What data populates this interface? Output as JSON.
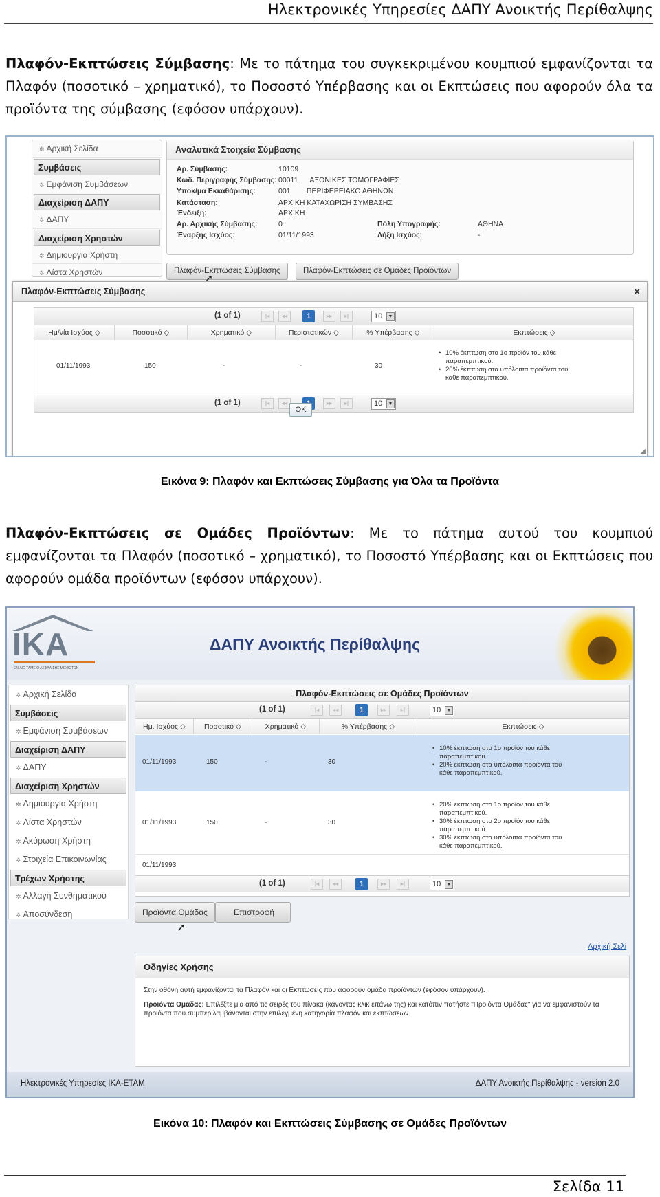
{
  "header": {
    "title": "Ηλεκτρονικές Υπηρεσίες ΔΑΠΥ Ανοικτής Περίθαλψης"
  },
  "intro": {
    "bold": "Πλαφόν-Εκπτώσεις Σύμβασης",
    "text": ": Με το πάτημα του συγκεκριμένου κουμπιού εμφανίζονται τα Πλαφόν (ποσοτικό – χρηματικό), το Ποσοστό Υπέρβασης και οι Εκπτώσεις που αφορούν όλα τα προϊόντα της σύμβασης (εφόσον υπάρχουν)."
  },
  "fig1": {
    "nav": {
      "home": "Αρχική Σελίδα",
      "contracts_head": "Συμβάσεις",
      "show_contracts": "Εμφάνιση Συμβάσεων",
      "dapy_head": "Διαχείριση ΔΑΠΥ",
      "dapy": "ΔΑΠΥ",
      "users_head": "Διαχείριση Χρηστών",
      "create_user": "Δημιουργία Χρήστη",
      "user_list": "Λίστα Χρηστών"
    },
    "details": {
      "title": "Αναλυτικά Στοιχεία Σύμβασης",
      "rows": [
        {
          "label": "Αρ. Σύμβασης:",
          "value": "10109"
        },
        {
          "label": "Κωδ. Περιγραφής Σύμβασης:",
          "value": "00011      ΑΞΟΝΙΚΕΣ ΤΟΜΟΓΡΑΦΙΕΣ"
        },
        {
          "label": "Υποκ/μα Εκκαθάρισης:",
          "value": "001        ΠΕΡΙΦΕΡΕΙΑΚΟ ΑΘΗΝΩΝ"
        },
        {
          "label": "Κατάσταση:",
          "value": "ΑΡΧΙΚΗ ΚΑΤΑΧΩΡΙΣΗ ΣΥΜΒΑΣΗΣ"
        },
        {
          "label": "Ένδειξη:",
          "value": "ΑΡΧΙΚΗ"
        },
        {
          "label": "Αρ. Αρχικής Σύμβασης:",
          "value": "0"
        },
        {
          "label": "Έναρξης Ισχύος:",
          "value": "01/11/1993"
        }
      ],
      "right": [
        {
          "label": "Πόλη Υπογραφής:",
          "value": "ΑΘΗΝΑ"
        },
        {
          "label": "Λήξη Ισχύος:",
          "value": "-"
        }
      ]
    },
    "btn_limits": "Πλαφόν-Εκπτώσεις Σύμβασης",
    "btn_groups": "Πλαφόν-Εκπτώσεις σε Ομάδες Προϊόντων",
    "dialog": {
      "title": "Πλαφόν-Εκπτώσεις Σύμβασης",
      "close": "×",
      "pager_text": "(1 of 1)",
      "page": "1",
      "page_size": "10",
      "columns": [
        "Ημ/νία Ισχύος",
        "Ποσοτικό",
        "Χρηματικό",
        "Περιστατικών",
        "% Υπέρβασης",
        "Εκπτώσεις"
      ],
      "row": {
        "date": "01/11/1993",
        "qty": "150",
        "money": "-",
        "cases": "-",
        "pct": "30",
        "discounts": [
          "10% έκπτωση στο 1ο προϊόν του κάθε παραπεμπτικού.",
          "20% έκπτωση στα υπόλοιπα προϊόντα του κάθε παραπεμπτικού."
        ]
      },
      "ok": "OK"
    }
  },
  "caption1": "Εικόνα 9: Πλαφόν και Εκπτώσεις Σύμβασης για Όλα τα Προϊόντα",
  "para2": {
    "bold": "Πλαφόν-Εκπτώσεις σε Ομάδες Προϊόντων",
    "text": ": Με το πάτημα αυτού του κουμπιού εμφανίζονται τα Πλαφόν (ποσοτικό – χρηματικό), το Ποσοστό Υπέρβασης και οι Εκπτώσεις που αφορούν ομάδα προϊόντων (εφόσον υπάρχουν)."
  },
  "fig2": {
    "logo": "IKA",
    "logo_sub": "ΕΝΙΑΙΟ ΤΑΜΕΙΟ ΑΣΦΑΛΙΣΗΣ ΜΙΣΘΩΤΩΝ",
    "app_title": "ΔΑΠΥ Ανοικτής Περίθαλψης",
    "nav": {
      "home": "Αρχική Σελίδα",
      "contracts_head": "Συμβάσεις",
      "show_contracts": "Εμφάνιση Συμβάσεων",
      "dapy_head": "Διαχείριση ΔΑΠΥ",
      "dapy": "ΔΑΠΥ",
      "users_head": "Διαχείριση Χρηστών",
      "create_user": "Δημιουργία Χρήστη",
      "user_list": "Λίστα Χρηστών",
      "cancel_user": "Ακύρωση Χρήστη",
      "contact": "Στοιχεία Επικοινωνίας",
      "current_head": "Τρέχων Χρήστης",
      "change_pwd": "Αλλαγή Συνθηματικού",
      "logout": "Αποσύνδεση"
    },
    "panel": {
      "title": "Πλαφόν-Εκπτώσεις σε Ομάδες Προϊόντων",
      "pager_text": "(1 of 1)",
      "page": "1",
      "page_size": "10",
      "columns": [
        "Ημ. Ισχύος",
        "Ποσοτικό",
        "Χρηματικό",
        "% Υπέρβασης",
        "Εκπτώσεις"
      ],
      "rows": [
        {
          "date": "01/11/1993",
          "qty": "150",
          "money": "-",
          "pct": "30",
          "discounts": [
            "10% έκπτωση στο 1ο προϊόν του κάθε παραπεμπτικού.",
            "20% έκπτωση στα υπόλοιπα προϊόντα του κάθε παραπεμπτικού."
          ]
        },
        {
          "date": "01/11/1993",
          "qty": "150",
          "money": "-",
          "pct": "30",
          "discounts": [
            "20% έκπτωση στο 1ο προϊόν του κάθε παραπεμπτικού.",
            "30% έκπτωση στο 2ο προϊόν του κάθε παραπεμπτικού.",
            "30% έκπτωση στα υπόλοιπα προϊόντα του κάθε παραπεμπτικού."
          ]
        },
        {
          "date": "01/11/1993",
          "qty": "",
          "money": "",
          "pct": "",
          "discounts": []
        }
      ]
    },
    "btn_groups": "Προϊόντα Ομάδας",
    "btn_back": "Επιστροφή",
    "link_home": "Αρχική Σελί",
    "instructions": {
      "title": "Οδηγίες Χρήσης",
      "line1": "Στην οθόνη αυτή εμφανίζονται τα Πλαφόν και οι Εκπτώσεις που αφορούν ομάδα προϊόντων (εφόσον υπάρχουν).",
      "bold": "Προϊόντα Ομάδας:",
      "line2": " Επιλέξτε μια από τις σειρές του πίνακα (κάνοντας κλικ επάνω της) και κατόπιν πατήστε \"Προϊόντα Ομάδας\" για να εμφανιστούν τα προϊόντα που συμπεριλαμβάνονται στην επιλεγμένη κατηγορία πλαφόν και εκπτώσεων."
    },
    "footer_left": "Ηλεκτρονικές Υπηρεσίες ΙΚΑ-ΕΤΑΜ",
    "footer_right": "ΔΑΠΥ Ανοικτής Περίθαλψης - version 2.0"
  },
  "caption2": "Εικόνα 10: Πλαφόν και Εκπτώσεις Σύμβασης σε Ομάδες Προϊόντων",
  "page": "Σελίδα 11"
}
